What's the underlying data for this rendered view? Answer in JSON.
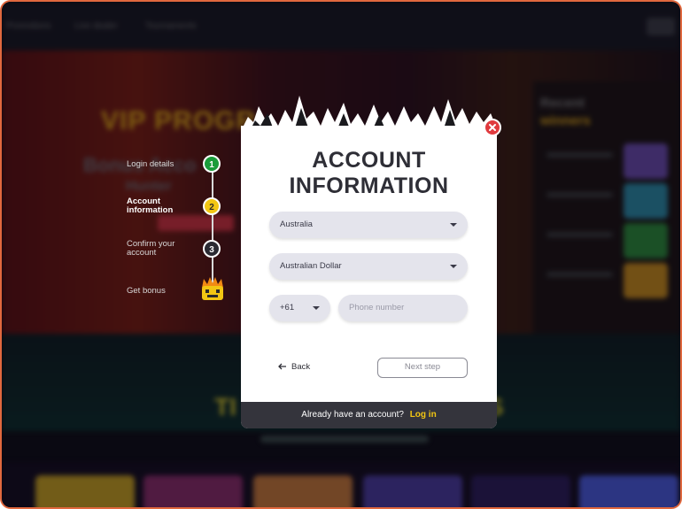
{
  "background": {
    "nav_items": [
      "Promotions",
      "Live dealer",
      "Tournaments"
    ],
    "hero_title": "VIP PROGR",
    "hero_subtitle": "Bonus Acco",
    "hero_subtitle2": "Hunter",
    "winners_title": "Recent",
    "winners_title2": "winners",
    "section_title": "TI",
    "section_title_end": "S"
  },
  "steps": [
    {
      "label": "Login details",
      "number": "1",
      "state": "done"
    },
    {
      "label": "Account information",
      "number": "2",
      "state": "active"
    },
    {
      "label": "Confirm your account",
      "number": "3",
      "state": "pending"
    },
    {
      "label": "Get bonus",
      "icon": "monster-bonus-icon"
    }
  ],
  "modal": {
    "title_line1": "ACCOUNT",
    "title_line2": "INFORMATION",
    "country_value": "Australia",
    "currency_value": "Australian Dollar",
    "phone_code_value": "+61",
    "phone_placeholder": "Phone number",
    "back_label": "Back",
    "next_label": "Next step",
    "footer_text": "Already have an account?",
    "footer_link": "Log in"
  },
  "colors": {
    "accent_yellow": "#f2c613",
    "success_green": "#1a9c3a",
    "close_red": "#e03a3e",
    "footer_dark": "#34343c",
    "frame_border": "#e0683e"
  }
}
